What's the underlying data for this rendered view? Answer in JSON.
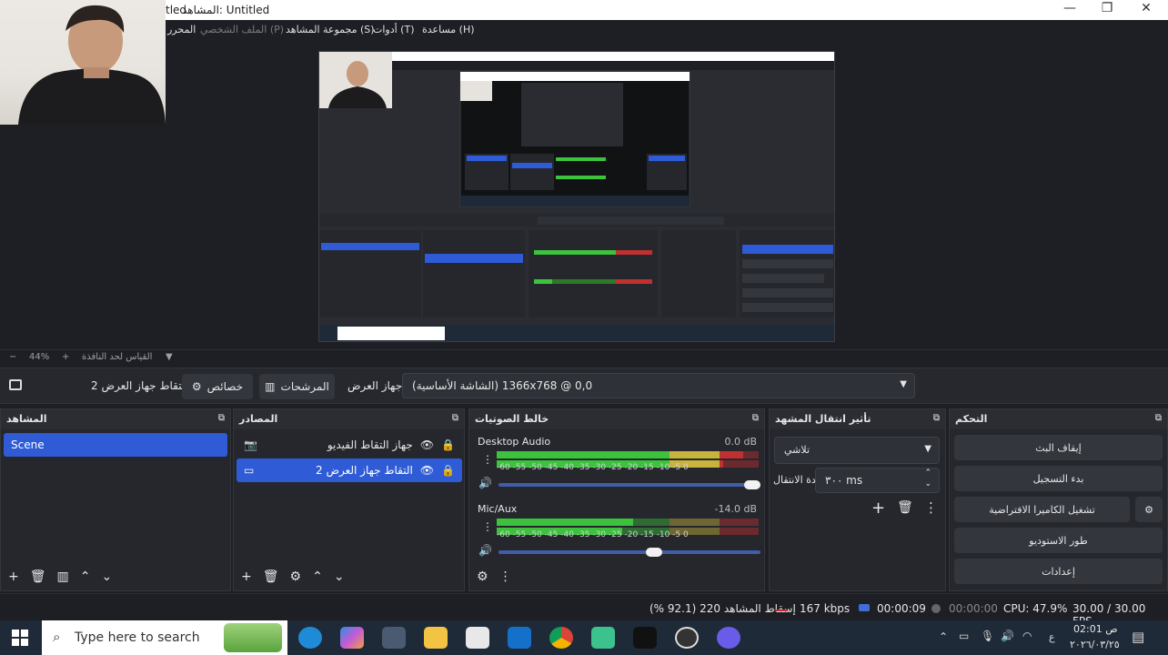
{
  "window": {
    "title": "المشاهد: Untitled",
    "title_prefix": "tled",
    "controls": [
      "—",
      "❐",
      "✕"
    ]
  },
  "menu": {
    "items": [
      {
        "label": "المحرر",
        "dim": false
      },
      {
        "label": "الملف الشخصي (P)",
        "dim": true
      },
      {
        "label": "مجموعة المشاهد (S)",
        "dim": false
      },
      {
        "label": "أدوات (T)",
        "dim": false
      },
      {
        "label": "مساعدة (H)",
        "dim": false
      }
    ]
  },
  "zoombar": {
    "zoom": "44%",
    "label": "القياس لحد النافذة"
  },
  "sourcebar": {
    "source_name": "التقاط جهاز العرض 2",
    "properties_label": "خصائص",
    "filters_label": "المرشحات",
    "display_label": "جهاز العرض",
    "display_value": "(الشاشة الأساسية) 1366x768 @ 0,0"
  },
  "docks": {
    "scenes": {
      "title": "المشاهد",
      "items": [
        "Scene"
      ]
    },
    "sources": {
      "title": "المصادر",
      "items": [
        {
          "label": "جهاز التقاط الفيديو",
          "icon": "camera-icon",
          "selected": false
        },
        {
          "label": "التقاط جهاز العرض 2",
          "icon": "monitor-icon",
          "selected": true
        }
      ]
    },
    "mixer": {
      "title": "خالط الصوتيات",
      "channels": [
        {
          "name": "Desktop Audio",
          "db": "0.0 dB",
          "level": 0.94,
          "volume": 1.0
        },
        {
          "name": "Mic/Aux",
          "db": "-14.0 dB",
          "level": 0.52,
          "volume": 0.6
        }
      ],
      "ticks": "-60  -55  -50  -45  -40  -35  -30  -25  -20  -15  -10   -5    0"
    },
    "transitions": {
      "title": "تأثير انتقال المشهد",
      "type": "تلاشي",
      "duration_label": "مدة الانتقال",
      "duration_value": "٣٠٠ ms"
    },
    "controls": {
      "title": "التحكم",
      "buttons": [
        "إيقاف البث",
        "بدء التسجيل",
        "تشغيل الكاميرا الافتراضية",
        "طور الاستوديو",
        "إعدادات"
      ]
    }
  },
  "status": {
    "dropped": "إسقاط المشاهد 220 (92.1 %)",
    "bitrate": "167 kbps",
    "live_time": "00:00:09",
    "rec_time": "00:00:00",
    "cpu": "CPU: 47.9%",
    "fps": "30.00 / 30.00 FPS"
  },
  "taskbar": {
    "search_placeholder": "Type here to search",
    "time": "02:01 ص",
    "date": "٢٠٢٦/٠٣/٢٥",
    "lang": "ع"
  },
  "colors": {
    "accent": "#2f5cd6",
    "meter_green": "#3cc23c",
    "meter_yellow": "#c8b43c",
    "meter_red": "#c03030"
  }
}
